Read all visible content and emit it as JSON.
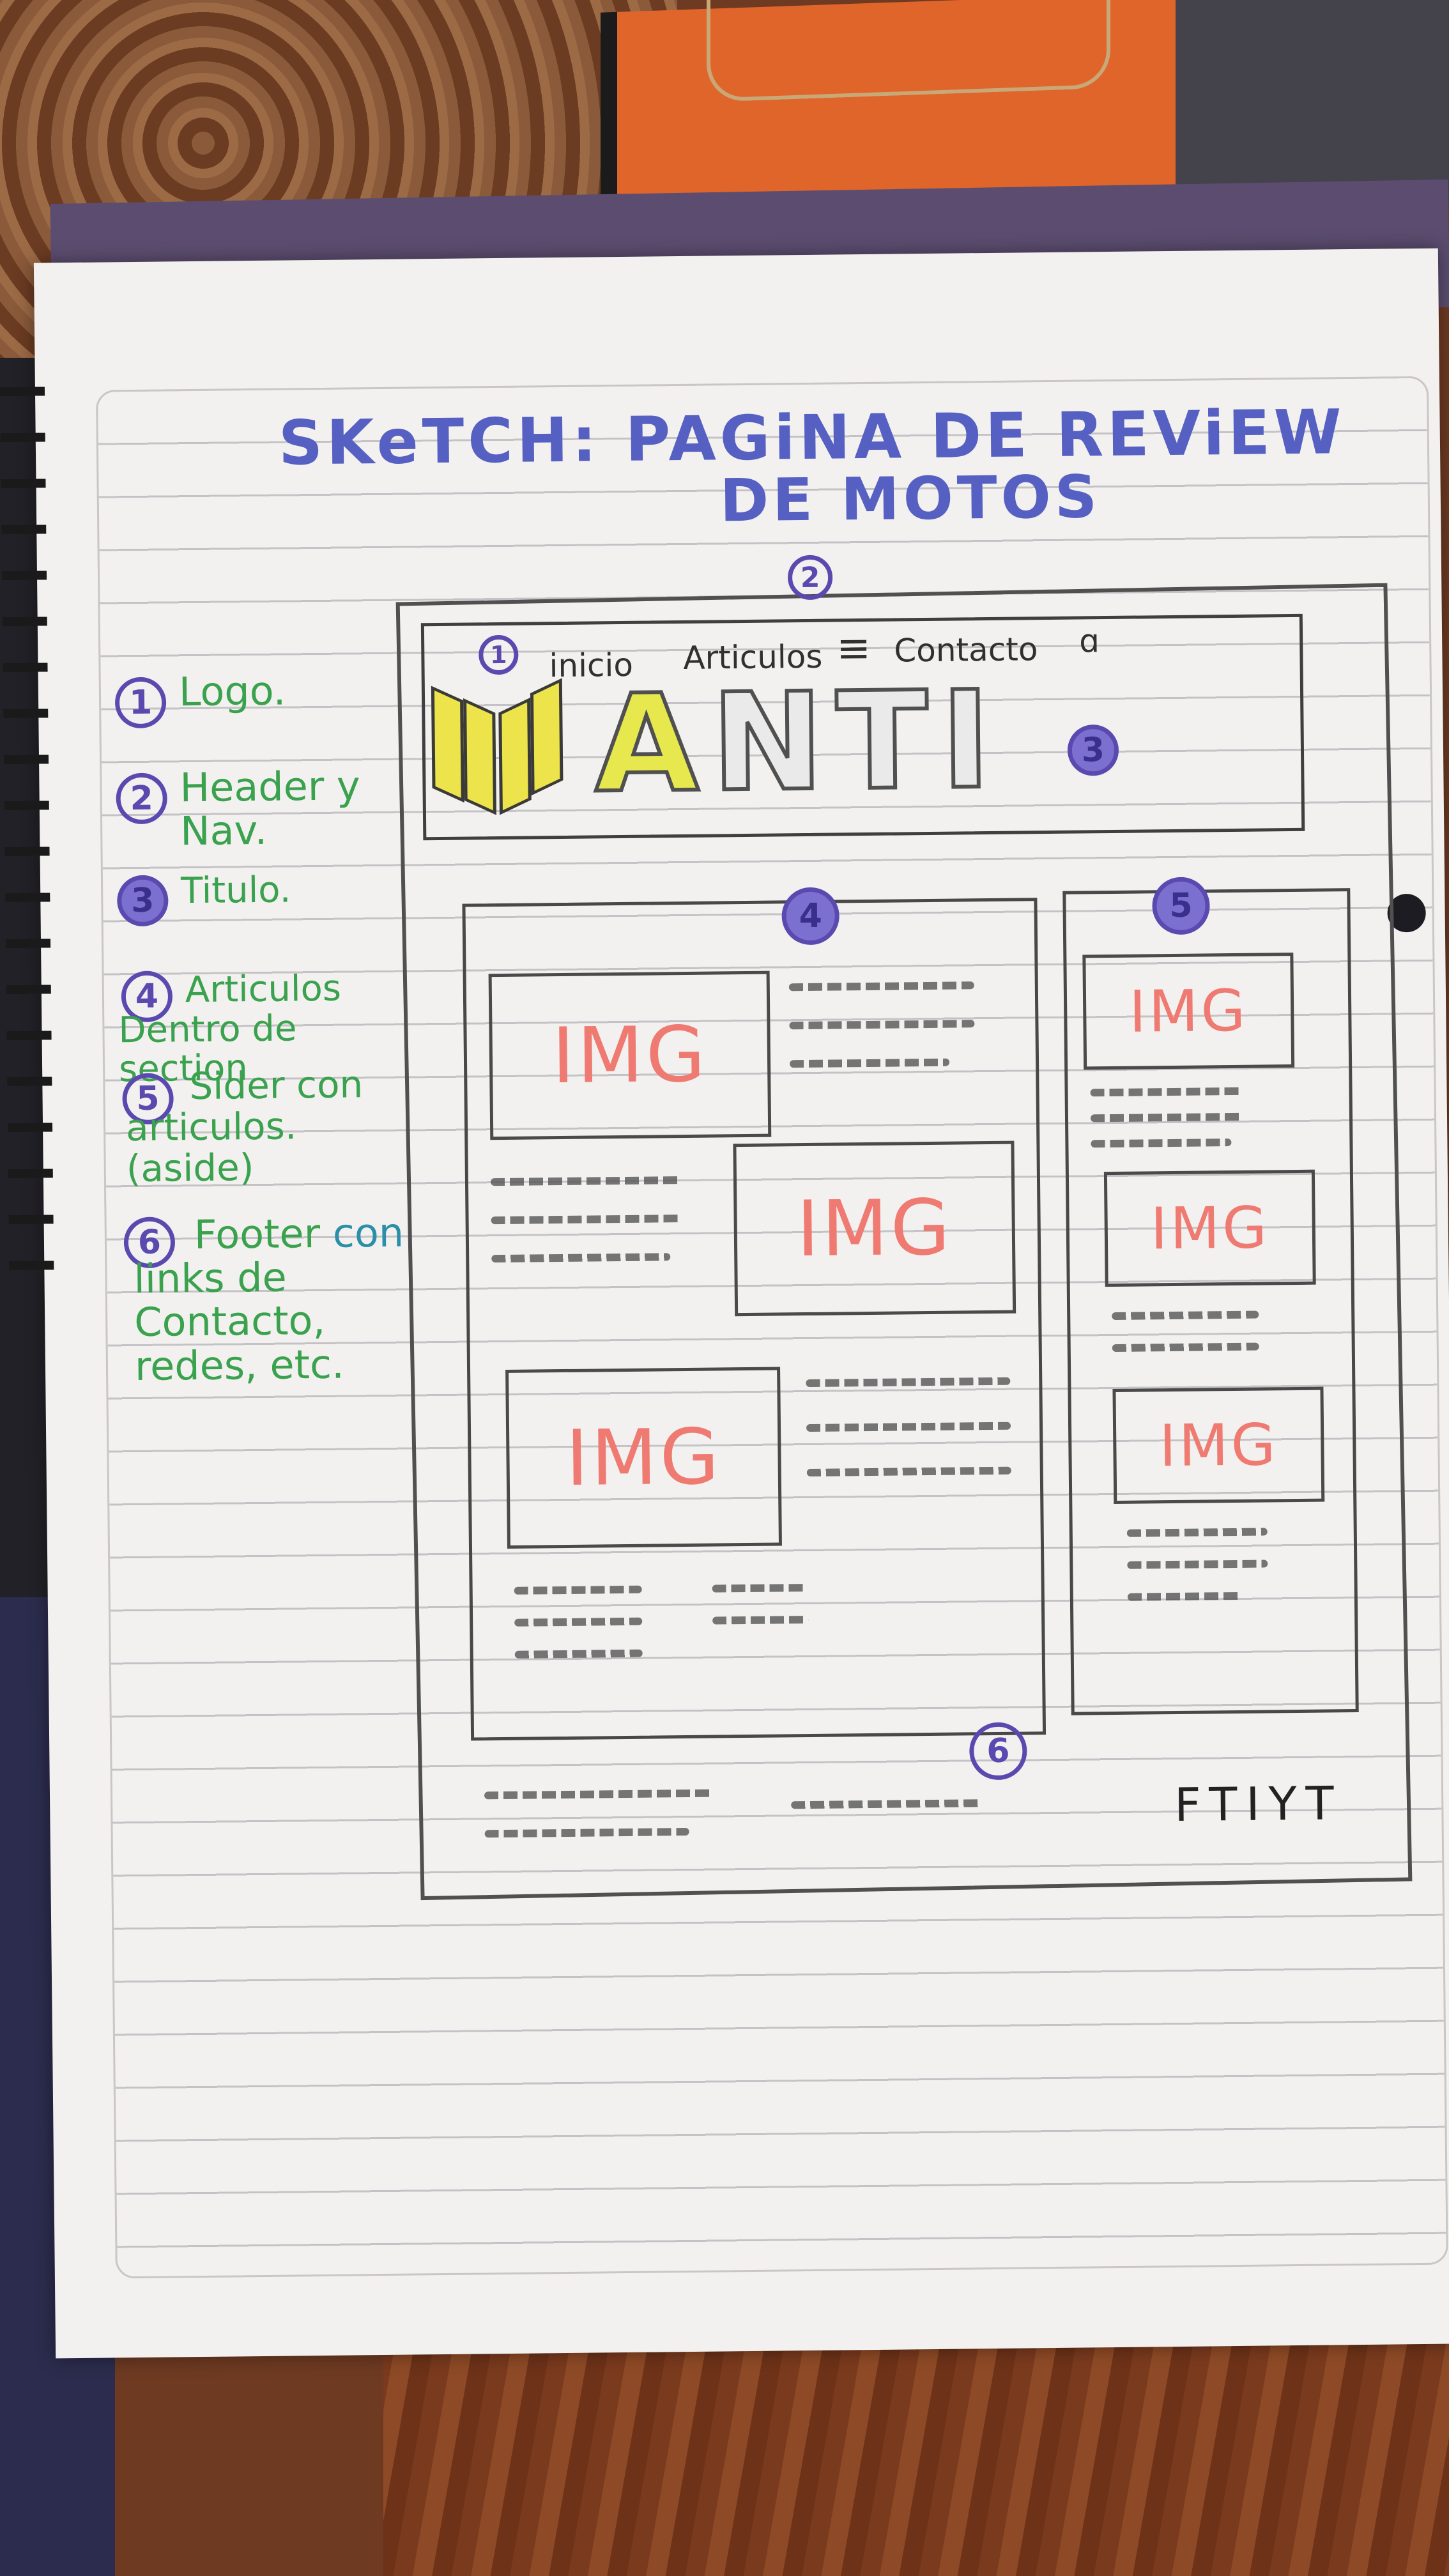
{
  "title": {
    "line1": "SKeTCH: PAGiNA DE REViEW",
    "line2": "DE MOTOS"
  },
  "legend": [
    {
      "num": "1",
      "text": "Logo."
    },
    {
      "num": "2",
      "text": "Header y Nav."
    },
    {
      "num": "3",
      "text": "Titulo."
    },
    {
      "num": "4",
      "text": "Articulos Dentro de section"
    },
    {
      "num": "5",
      "text": "Sider con articulos. (aside)"
    },
    {
      "num": "6",
      "text_green": "Footer",
      "text_teal": "con",
      "text_rest": "links de Contacto, redes, etc."
    }
  ],
  "badges": {
    "b1": "1",
    "b2": "2",
    "b3": "3",
    "b4": "4",
    "b5": "5",
    "b6": "6"
  },
  "nav": {
    "inicio": "inicio",
    "articulos": "Articulos",
    "menu": "≡",
    "contacto": "Contacto",
    "search": "ɑ"
  },
  "brand": {
    "first": "A",
    "rest": "NTI"
  },
  "image_placeholder": "IMG",
  "footer": {
    "social": "FTIYT"
  },
  "colors": {
    "title": "#5660c2",
    "legend_green": "#3aa24e",
    "legend_teal": "#2b8fa8",
    "badge": "#5a4ab0",
    "img_text": "#ef7a72",
    "logo_yellow": "#ece44a"
  }
}
